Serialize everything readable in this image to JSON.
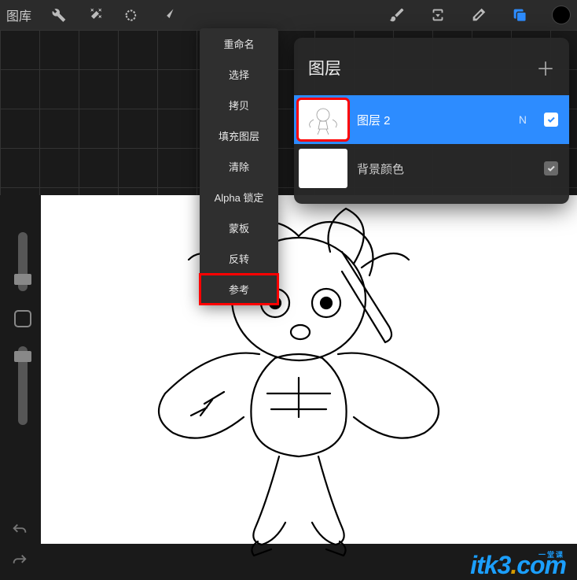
{
  "toolbar": {
    "gallery_label": "图库",
    "icons": [
      "wrench",
      "magic",
      "selection",
      "arrow"
    ],
    "right_icons": [
      "brush",
      "smudge",
      "eraser",
      "layers"
    ],
    "color": "#000000"
  },
  "context_menu": {
    "items": [
      {
        "label": "重命名",
        "highlighted": false
      },
      {
        "label": "选择",
        "highlighted": false
      },
      {
        "label": "拷贝",
        "highlighted": false
      },
      {
        "label": "填充图层",
        "highlighted": false
      },
      {
        "label": "清除",
        "highlighted": false
      },
      {
        "label": "Alpha 锁定",
        "highlighted": false
      },
      {
        "label": "蒙板",
        "highlighted": false
      },
      {
        "label": "反转",
        "highlighted": false
      },
      {
        "label": "参考",
        "highlighted": true
      }
    ]
  },
  "layers_panel": {
    "title": "图层",
    "layers": [
      {
        "name": "图层 2",
        "blend": "N",
        "selected": true,
        "visible": true,
        "highlighted": true
      },
      {
        "name": "背景颜色",
        "blend": "",
        "selected": false,
        "visible": true,
        "highlighted": false
      }
    ]
  },
  "watermark": {
    "brand": "itk3",
    "suffix": "com",
    "sub": "一堂课"
  }
}
